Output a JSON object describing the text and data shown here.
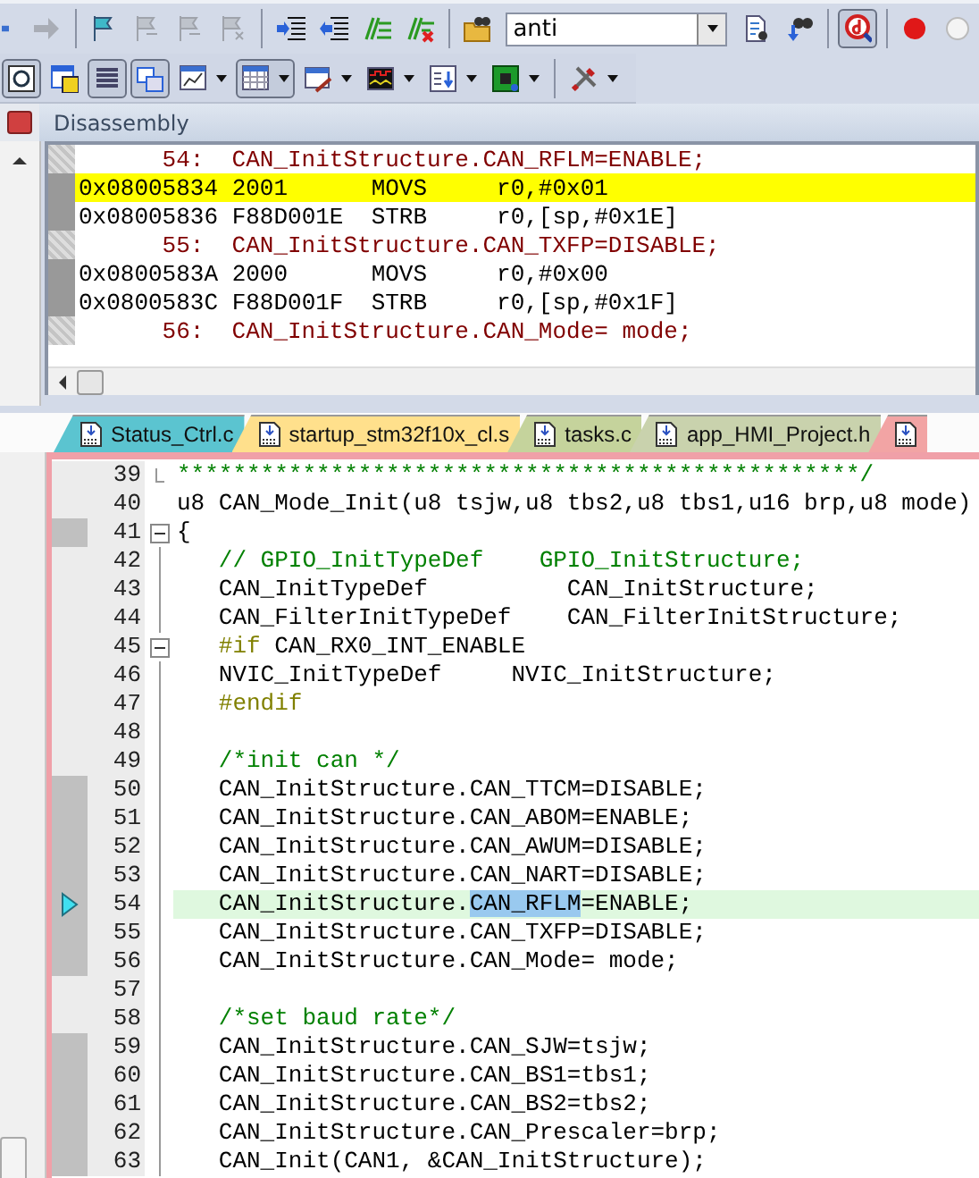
{
  "toolbar_top": [
    {
      "kind": "button",
      "disabled": false,
      "pressed": false
    },
    {
      "kind": "button",
      "disabled": true,
      "pressed": false
    },
    {
      "kind": "separator"
    },
    {
      "kind": "button",
      "disabled": false,
      "pressed": false
    },
    {
      "kind": "button",
      "disabled": true,
      "pressed": false
    },
    {
      "kind": "button",
      "disabled": true,
      "pressed": false
    },
    {
      "kind": "button",
      "disabled": true,
      "pressed": false
    },
    {
      "kind": "separator"
    },
    {
      "kind": "button",
      "disabled": false,
      "pressed": false
    },
    {
      "kind": "button",
      "disabled": false,
      "pressed": false
    },
    {
      "kind": "button",
      "disabled": false,
      "pressed": false
    },
    {
      "kind": "button",
      "disabled": false,
      "pressed": false
    },
    {
      "kind": "separator"
    },
    {
      "kind": "button",
      "disabled": false,
      "pressed": false
    },
    {
      "kind": "combo",
      "value": "anti"
    },
    {
      "kind": "button",
      "disabled": false,
      "pressed": false
    },
    {
      "kind": "button",
      "disabled": false,
      "pressed": false
    },
    {
      "kind": "separator"
    },
    {
      "kind": "button",
      "disabled": false,
      "pressed": true
    },
    {
      "kind": "separator"
    },
    {
      "kind": "button",
      "disabled": false,
      "pressed": false
    },
    {
      "kind": "button",
      "disabled": false,
      "pressed": false
    }
  ],
  "toolbar_bottom": [
    {
      "kind": "button",
      "pressed": true,
      "dropdown": false
    },
    {
      "kind": "button",
      "pressed": false,
      "dropdown": false
    },
    {
      "kind": "button",
      "pressed": true,
      "dropdown": false
    },
    {
      "kind": "button",
      "pressed": true,
      "dropdown": false
    },
    {
      "kind": "button",
      "pressed": false,
      "dropdown": true
    },
    {
      "kind": "button",
      "pressed": true,
      "dropdown": true
    },
    {
      "kind": "button",
      "pressed": false,
      "dropdown": true
    },
    {
      "kind": "button",
      "pressed": false,
      "dropdown": true
    },
    {
      "kind": "button",
      "pressed": false,
      "dropdown": true
    },
    {
      "kind": "button",
      "pressed": false,
      "dropdown": true
    },
    {
      "kind": "separator"
    },
    {
      "kind": "button",
      "pressed": false,
      "dropdown": true
    }
  ],
  "disassembly": {
    "title": "Disassembly",
    "lines": [
      {
        "kind": "source",
        "number": "54:",
        "code": "CAN_InitStructure.CAN_RFLM=ENABLE;",
        "current": false
      },
      {
        "kind": "asm",
        "address": "0x08005834",
        "opcode": "2001",
        "mnemonic": "MOVS",
        "operands": "r0,#0x01",
        "current": true
      },
      {
        "kind": "asm",
        "address": "0x08005836",
        "opcode": "F88D001E",
        "mnemonic": "STRB",
        "operands": "r0,[sp,#0x1E]",
        "current": false
      },
      {
        "kind": "source",
        "number": "55:",
        "code": "CAN_InitStructure.CAN_TXFP=DISABLE;",
        "current": false
      },
      {
        "kind": "asm",
        "address": "0x0800583A",
        "opcode": "2000",
        "mnemonic": "MOVS",
        "operands": "r0,#0x00",
        "current": false
      },
      {
        "kind": "asm",
        "address": "0x0800583C",
        "opcode": "F88D001F",
        "mnemonic": "STRB",
        "operands": "r0,[sp,#0x1F]",
        "current": false
      },
      {
        "kind": "source",
        "number": "56:",
        "code": "CAN_InitStructure.CAN_Mode= mode;",
        "current": false
      }
    ]
  },
  "editor_tabs": [
    {
      "label": "Status_Ctrl.c",
      "color": "#5bc4d0"
    },
    {
      "label": "startup_stm32f10x_cl.s",
      "color": "#ffe08c"
    },
    {
      "label": "tasks.c",
      "color": "#c5d39c"
    },
    {
      "label": "app_HMI_Project.h",
      "color": "#c9d2ad"
    },
    {
      "color": "#f2a4a4"
    }
  ],
  "editor": {
    "lines": [
      {
        "number": "39",
        "executable": false,
        "current": false,
        "segments": [
          {
            "kind": "comment",
            "text": "*************************************************/"
          }
        ]
      },
      {
        "number": "40",
        "executable": false,
        "current": false,
        "segments": [
          {
            "kind": "code",
            "text": "u8 CAN_Mode_Init(u8 tsjw,u8 tbs2,u8 tbs1,u16 brp,u8 mode)"
          }
        ]
      },
      {
        "number": "41",
        "executable": true,
        "current": false,
        "expanded": true,
        "segments": [
          {
            "kind": "code",
            "text": "{"
          }
        ]
      },
      {
        "number": "42",
        "executable": false,
        "current": false,
        "segments": [
          {
            "kind": "comment",
            "text": "   // GPIO_InitTypeDef    GPIO_InitStructure;"
          }
        ]
      },
      {
        "number": "43",
        "executable": false,
        "current": false,
        "segments": [
          {
            "kind": "code",
            "text": "   CAN_InitTypeDef          CAN_InitStructure;"
          }
        ]
      },
      {
        "number": "44",
        "executable": false,
        "current": false,
        "segments": [
          {
            "kind": "code",
            "text": "   CAN_FilterInitTypeDef    CAN_FilterInitStructure;"
          }
        ]
      },
      {
        "number": "45",
        "executable": false,
        "current": false,
        "expanded": true,
        "segments": [
          {
            "kind": "preproc",
            "text": "   #if"
          },
          {
            "kind": "code",
            "text": " CAN_RX0_INT_ENABLE"
          }
        ]
      },
      {
        "number": "46",
        "executable": false,
        "current": false,
        "segments": [
          {
            "kind": "code",
            "text": "   NVIC_InitTypeDef     NVIC_InitStructure;"
          }
        ]
      },
      {
        "number": "47",
        "executable": false,
        "current": false,
        "segments": [
          {
            "kind": "preproc",
            "text": "   #endif"
          }
        ]
      },
      {
        "number": "48",
        "executable": false,
        "current": false
      },
      {
        "number": "49",
        "executable": false,
        "current": false,
        "segments": [
          {
            "kind": "comment",
            "text": "   /*init can */"
          }
        ]
      },
      {
        "number": "50",
        "executable": true,
        "current": false,
        "segments": [
          {
            "kind": "code",
            "text": "   CAN_InitStructure.CAN_TTCM=DISABLE;"
          }
        ]
      },
      {
        "number": "51",
        "executable": true,
        "current": false,
        "segments": [
          {
            "kind": "code",
            "text": "   CAN_InitStructure.CAN_ABOM=ENABLE;"
          }
        ]
      },
      {
        "number": "52",
        "executable": true,
        "current": false,
        "segments": [
          {
            "kind": "code",
            "text": "   CAN_InitStructure.CAN_AWUM=DISABLE;"
          }
        ]
      },
      {
        "number": "53",
        "executable": true,
        "current": false,
        "segments": [
          {
            "kind": "code",
            "text": "   CAN_InitStructure.CAN_NART=DISABLE;"
          }
        ]
      },
      {
        "number": "54",
        "executable": true,
        "current": true,
        "segments": [
          {
            "kind": "code",
            "text": "   CAN_InitStructure."
          },
          {
            "kind": "selected",
            "text": "CAN_RFLM"
          },
          {
            "kind": "code",
            "text": "=ENABLE;"
          }
        ]
      },
      {
        "number": "55",
        "executable": true,
        "current": false,
        "segments": [
          {
            "kind": "code",
            "text": "   CAN_InitStructure.CAN_TXFP=DISABLE;"
          }
        ]
      },
      {
        "number": "56",
        "executable": true,
        "current": false,
        "segments": [
          {
            "kind": "code",
            "text": "   CAN_InitStructure.CAN_Mode= mode;"
          }
        ]
      },
      {
        "number": "57",
        "executable": false,
        "current": false
      },
      {
        "number": "58",
        "executable": false,
        "current": false,
        "segments": [
          {
            "kind": "comment",
            "text": "   /*set baud rate*/"
          }
        ]
      },
      {
        "number": "59",
        "executable": true,
        "current": false,
        "segments": [
          {
            "kind": "code",
            "text": "   CAN_InitStructure.CAN_SJW=tsjw;"
          }
        ]
      },
      {
        "number": "60",
        "executable": true,
        "current": false,
        "segments": [
          {
            "kind": "code",
            "text": "   CAN_InitStructure.CAN_BS1=tbs1;"
          }
        ]
      },
      {
        "number": "61",
        "executable": true,
        "current": false,
        "segments": [
          {
            "kind": "code",
            "text": "   CAN_InitStructure.CAN_BS2=tbs2;"
          }
        ]
      },
      {
        "number": "62",
        "executable": true,
        "current": false,
        "segments": [
          {
            "kind": "code",
            "text": "   CAN_InitStructure.CAN_Prescaler=brp;"
          }
        ]
      },
      {
        "number": "63",
        "executable": true,
        "current": false,
        "segments": [
          {
            "kind": "code",
            "text": "   CAN_Init(CAN1, &CAN_InitStructure);"
          }
        ]
      }
    ]
  }
}
